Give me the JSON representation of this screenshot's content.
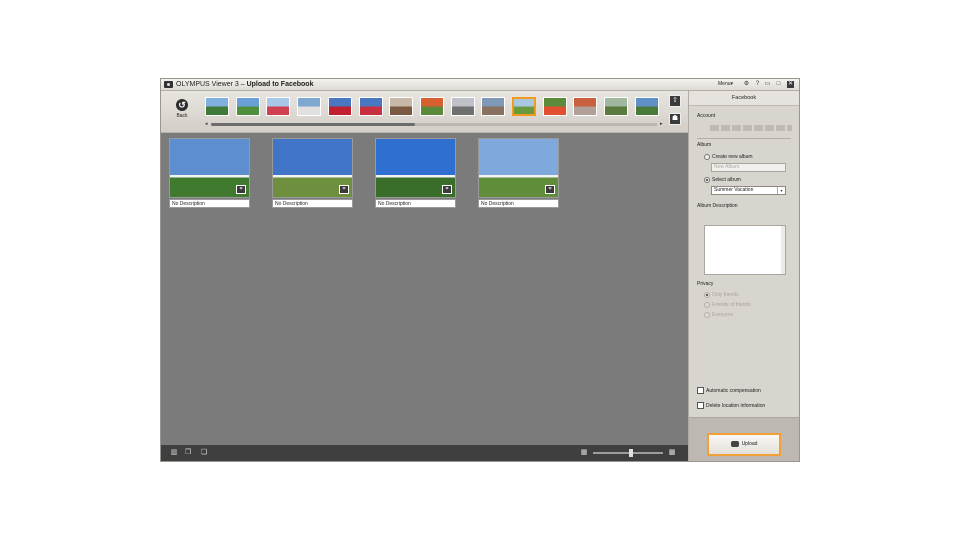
{
  "window": {
    "app_name": "OLYMPUS Viewer 3",
    "separator": "–",
    "title": "Upload to Facebook",
    "menu_label": "Menu▾"
  },
  "toolbar": {
    "back_label": "Back"
  },
  "filmstrip": {
    "thumbnails": [
      {
        "colors": [
          "#7fb0e0",
          "#3f7a3a"
        ]
      },
      {
        "colors": [
          "#6aa0d8",
          "#4f8f3e"
        ]
      },
      {
        "colors": [
          "#a8c8e8",
          "#d04050"
        ]
      },
      {
        "colors": [
          "#7fa8d0",
          "#e0e0e0"
        ]
      },
      {
        "colors": [
          "#4a78c0",
          "#c02030"
        ]
      },
      {
        "colors": [
          "#4a78c0",
          "#c83040"
        ]
      },
      {
        "colors": [
          "#c8b8a8",
          "#7a5a40"
        ]
      },
      {
        "colors": [
          "#d86030",
          "#5a8a3a"
        ]
      },
      {
        "colors": [
          "#c0c0c8",
          "#707070"
        ]
      },
      {
        "colors": [
          "#8098b8",
          "#8a7060"
        ]
      },
      {
        "colors": [
          "#a8c8e0",
          "#6a9a40"
        ]
      },
      {
        "colors": [
          "#5a8a3a",
          "#e05030"
        ]
      },
      {
        "colors": [
          "#c86040",
          "#b0a098"
        ]
      },
      {
        "colors": [
          "#a0b8a0",
          "#5a7a40"
        ]
      },
      {
        "colors": [
          "#6090c8",
          "#4a7a3a"
        ]
      }
    ],
    "selected_index": 10
  },
  "photos": [
    {
      "description": "No Description",
      "sky": "#5d8fd0",
      "ground": "#3f7a2e"
    },
    {
      "description": "No Description",
      "sky": "#3f74c8",
      "ground": "#6d8f3e"
    },
    {
      "description": "No Description",
      "sky": "#2f6fcf",
      "ground": "#3a6d2a"
    },
    {
      "description": "No Description",
      "sky": "#7fa9dc",
      "ground": "#5f8d3a"
    }
  ],
  "panel": {
    "title": "Facebook",
    "account_label": "Account",
    "album_label": "Album",
    "create_new_album": "Create new album",
    "new_album_placeholder": "New Album",
    "select_album": "Select album",
    "selected_album": "Summer Vacation",
    "album_description_label": "Album Description",
    "privacy_label": "Privacy",
    "privacy_options": [
      "Only friends",
      "Friends of friends",
      "Everyone"
    ],
    "auto_compensation": "Automatic compensation",
    "delete_location": "Delete location information",
    "upload_label": "Upload"
  },
  "colors": {
    "accent": "#f39a1e",
    "main_bg": "#7b7b7b"
  }
}
